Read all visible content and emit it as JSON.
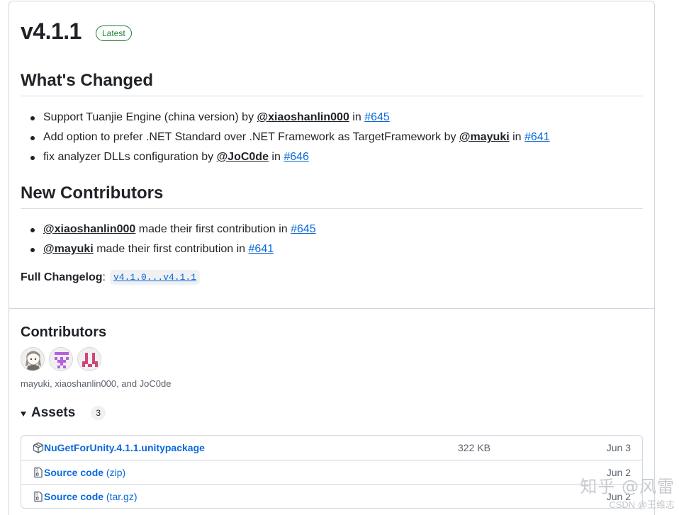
{
  "release": {
    "version": "v4.1.1",
    "badge": "Latest"
  },
  "whats_changed": {
    "heading": "What's Changed",
    "items": [
      {
        "text": "Support Tuanjie Engine (china version) by ",
        "user": "@xiaoshanlin000",
        "in": " in ",
        "pr": "#645"
      },
      {
        "text": "Add option to prefer .NET Standard over .NET Framework as TargetFramework by ",
        "user": "@mayuki",
        "in": " in ",
        "pr": "#641"
      },
      {
        "text": "fix analyzer DLLs configuration by ",
        "user": "@JoC0de",
        "in": " in ",
        "pr": "#646"
      }
    ]
  },
  "new_contributors": {
    "heading": "New Contributors",
    "items": [
      {
        "user": "@xiaoshanlin000",
        "text": " made their first contribution in ",
        "pr": "#645"
      },
      {
        "user": "@mayuki",
        "text": " made their first contribution in ",
        "pr": "#641"
      }
    ]
  },
  "changelog": {
    "label": "Full Changelog",
    "colon": ":",
    "link": "v4.1.0...v4.1.1"
  },
  "contributors": {
    "title": "Contributors",
    "names": "mayuki, xiaoshanlin000, and JoC0de",
    "avatars": [
      {
        "icon": "anime-avatar-icon",
        "colors": [
          "#8e8a86",
          "#e8e4df"
        ]
      },
      {
        "icon": "identicon-purple-icon",
        "colors": [
          "#b65fe0",
          "#ffffff"
        ]
      },
      {
        "icon": "identicon-pink-icon",
        "colors": [
          "#d1457a",
          "#ffffff"
        ]
      }
    ]
  },
  "assets": {
    "title": "Assets",
    "count": "3",
    "items": [
      {
        "icon": "package-icon",
        "name": "NuGetForUnity.4.1.1.unitypackage",
        "suffix": "",
        "size": "322 KB",
        "date": "Jun 3"
      },
      {
        "icon": "file-zip-icon",
        "name": "Source code",
        "suffix": " (zip)",
        "size": "",
        "date": "Jun 2"
      },
      {
        "icon": "file-zip-icon",
        "name": "Source code",
        "suffix": " (tar.gz)",
        "size": "",
        "date": "Jun 2"
      }
    ]
  },
  "watermark": {
    "main": "知乎 @风雷",
    "sub": "CSDN @王维志"
  },
  "colors": {
    "link": "#0969da",
    "badge_green": "#1a7f37",
    "border": "#d0d7de",
    "muted_text": "#59636e"
  }
}
